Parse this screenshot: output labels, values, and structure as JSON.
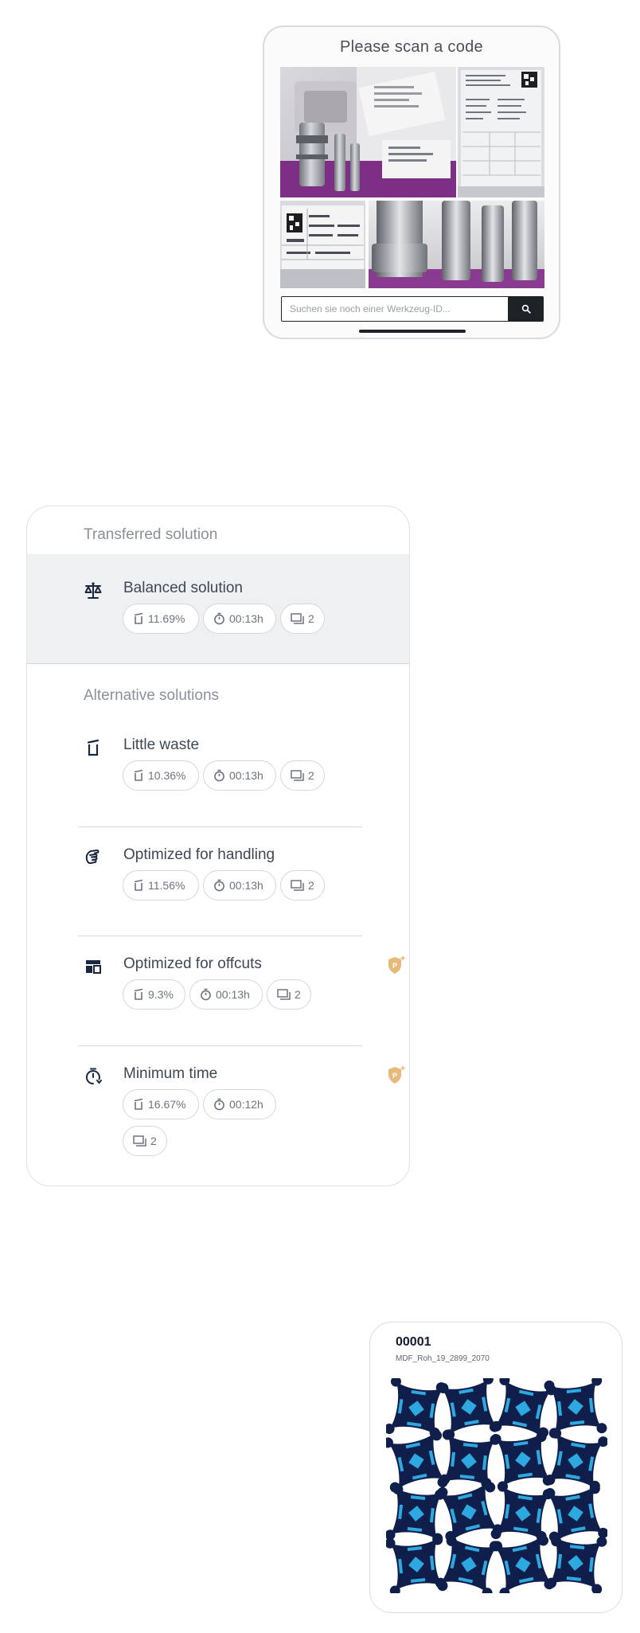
{
  "scan": {
    "title": "Please scan a code",
    "search_placeholder": "Suchen sie noch einer Werkzeug-ID...",
    "search_button_icon": "search-icon"
  },
  "solutions": {
    "transferred_title": "Transferred solution",
    "alternatives_title": "Alternative solutions",
    "transferred": {
      "name": "Balanced solution",
      "icon": "balance-scale-icon",
      "waste": "11.69%",
      "time": "00:13h",
      "plates": "2"
    },
    "alternatives": [
      {
        "name": "Little waste",
        "icon": "waste-bin-icon",
        "waste": "10.36%",
        "time": "00:13h",
        "plates": "2",
        "premium": false
      },
      {
        "name": "Optimized for handling",
        "icon": "hand-icon",
        "waste": "11.56%",
        "time": "00:13h",
        "plates": "2",
        "premium": false
      },
      {
        "name": "Optimized for offcuts",
        "icon": "offcuts-layout-icon",
        "waste": "9.3%",
        "time": "00:13h",
        "plates": "2",
        "premium": true
      },
      {
        "name": "Minimum time",
        "icon": "timer-icon",
        "waste": "16.67%",
        "time": "00:12h",
        "plates": "2",
        "premium": true
      }
    ]
  },
  "plate": {
    "id": "00001",
    "material": "MDF_Roh_19_2899_2070"
  },
  "colors": {
    "part_dark": "#0f1e4a",
    "part_light": "#2ea9e0",
    "premium_badge": "#e7b97a",
    "search_button": "#1e2126"
  }
}
